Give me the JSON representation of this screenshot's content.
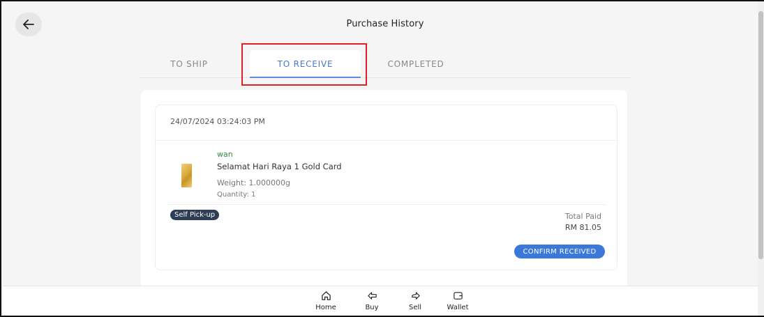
{
  "header": {
    "title": "Purchase History",
    "back_icon": "arrow-left-icon"
  },
  "tabs": [
    {
      "label": "TO SHIP",
      "active": false
    },
    {
      "label": "TO RECEIVE",
      "active": true
    },
    {
      "label": "COMPLETED",
      "active": false
    }
  ],
  "order": {
    "date": "24/07/2024 03:24:03 PM",
    "seller": "wan",
    "product_name": "Selamat Hari Raya 1 Gold Card",
    "weight": "Weight: 1.000000g",
    "quantity": "Quantity: 1",
    "delivery_badge": "Self Pick-up",
    "total_label": "Total Paid",
    "total_value": "RM 81.05",
    "confirm_label": "CONFIRM RECEIVED"
  },
  "bottom_nav": [
    {
      "label": "Home",
      "icon": "home-icon"
    },
    {
      "label": "Buy",
      "icon": "buy-arrow-icon"
    },
    {
      "label": "Sell",
      "icon": "sell-arrow-icon"
    },
    {
      "label": "Wallet",
      "icon": "wallet-icon"
    }
  ],
  "colors": {
    "accent": "#3b78d8",
    "active_tab_text": "#4a78c8",
    "seller_green": "#2e8f3a",
    "badge_bg": "#2d3e55",
    "highlight_red": "#e0202a"
  }
}
